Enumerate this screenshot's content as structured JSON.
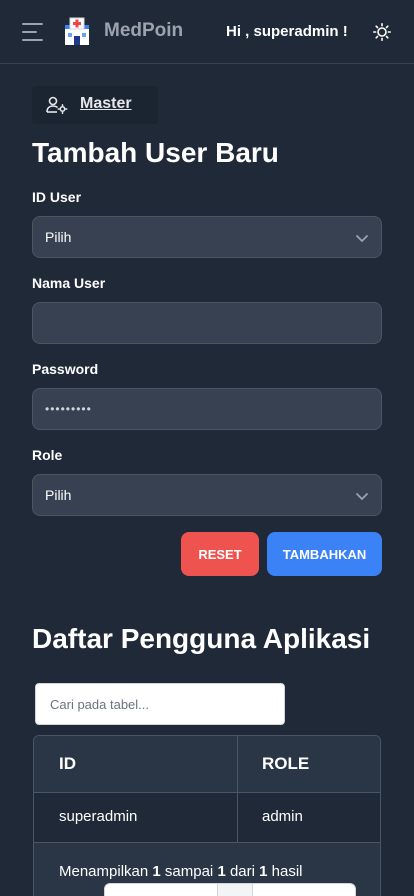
{
  "header": {
    "brand": "MedPoin",
    "greeting": "Hi , superadmin !"
  },
  "breadcrumb": {
    "label": "Master"
  },
  "form": {
    "title": "Tambah User Baru",
    "id_user_label": "ID User",
    "id_user_value": "Pilih",
    "nama_user_label": "Nama User",
    "nama_user_value": "",
    "password_label": "Password",
    "password_value": "•••••••••",
    "role_label": "Role",
    "role_value": "Pilih",
    "reset_label": "RESET",
    "add_label": "TAMBAHKAN"
  },
  "table": {
    "title": "Daftar Pengguna Aplikasi",
    "search_placeholder": "Cari pada tabel...",
    "columns": [
      "ID",
      "ROLE"
    ],
    "rows": [
      [
        "superadmin",
        "admin"
      ]
    ],
    "footer_prefix": "Menampilkan ",
    "footer_from": "1",
    "footer_mid1": " sampai ",
    "footer_to": "1",
    "footer_mid2": " dari ",
    "footer_total": "1",
    "footer_suffix": " hasil"
  },
  "colors": {
    "background": "#1f2937",
    "input": "#374151",
    "reset": "#ef5350",
    "add": "#3b82f6"
  },
  "icons": [
    "menu-icon",
    "medpoin-logo",
    "theme-toggle-icon",
    "user-settings-icon",
    "chevron-down-icon"
  ]
}
